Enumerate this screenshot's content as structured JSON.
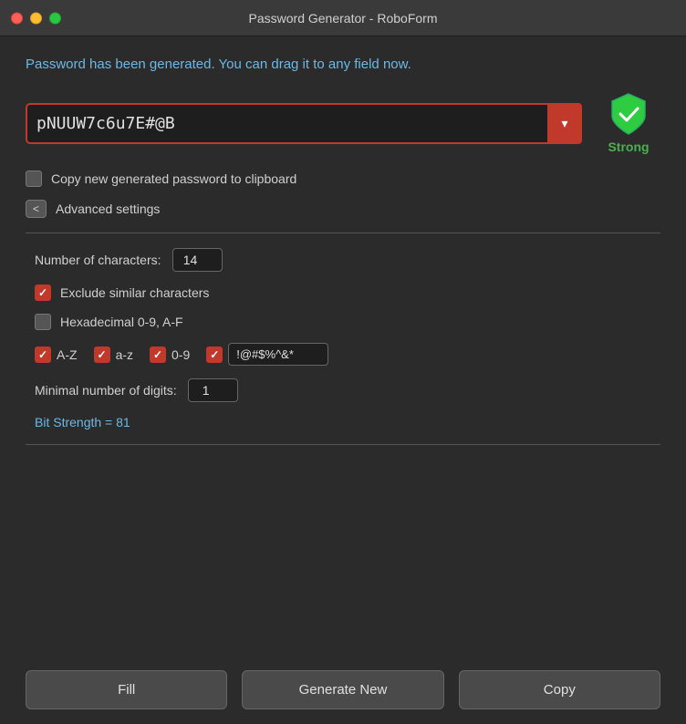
{
  "titleBar": {
    "title": "Password Generator - RoboForm"
  },
  "statusMessage": "Password has been generated. You can drag it to any field now.",
  "passwordField": {
    "value": "pNUUW7c6u7E#@B",
    "placeholder": ""
  },
  "dropdownArrow": "▾",
  "strength": {
    "label": "Strong"
  },
  "clipboardCheckbox": {
    "label": "Copy new generated password to clipboard",
    "checked": false
  },
  "advancedToggle": {
    "buttonLabel": "<",
    "label": "Advanced settings"
  },
  "settings": {
    "numCharsLabel": "Number of characters:",
    "numCharsValue": "14",
    "excludeSimilarLabel": "Exclude similar characters",
    "excludeSimilarChecked": true,
    "hexadecimalLabel": "Hexadecimal 0-9, A-F",
    "hexadecimalChecked": false,
    "azLabel": "A-Z",
    "azChecked": true,
    "azLowerLabel": "a-z",
    "azLowerChecked": true,
    "digitsLabel": "0-9",
    "digitsChecked": true,
    "specialChecked": true,
    "specialValue": "!@#$%^&*",
    "minDigitsLabel": "Minimal number of digits:",
    "minDigitsValue": "1",
    "bitStrength": "Bit Strength = 81"
  },
  "buttons": {
    "fill": "Fill",
    "generateNew": "Generate New",
    "copy": "Copy"
  }
}
